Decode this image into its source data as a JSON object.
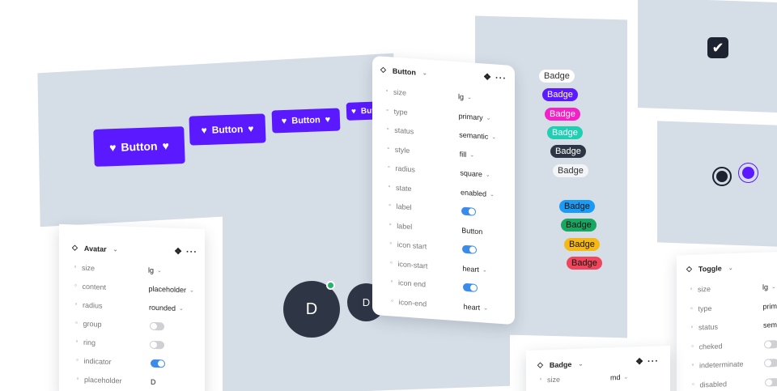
{
  "buttons": {
    "label": "Button",
    "icon": "heart-icon"
  },
  "badges_left": [
    "Badge",
    "Badge",
    "Badge",
    "Badge",
    "Badge",
    "Badge"
  ],
  "badges_right": [
    "Badge",
    "Badge",
    "Badge",
    "Badge"
  ],
  "avatar_initial": "D",
  "button_panel": {
    "title": "Button",
    "rows": [
      {
        "prop": "size",
        "value": "lg"
      },
      {
        "prop": "type",
        "value": "primary"
      },
      {
        "prop": "status",
        "value": "semantic"
      },
      {
        "prop": "style",
        "value": "fill"
      },
      {
        "prop": "radius",
        "value": "square"
      },
      {
        "prop": "state",
        "value": "enabled"
      },
      {
        "prop": "label",
        "value": ""
      },
      {
        "prop": "label",
        "value": "Button"
      },
      {
        "prop": "icon start",
        "value": ""
      },
      {
        "prop": "icon-start",
        "value": "heart"
      },
      {
        "prop": "icon end",
        "value": ""
      },
      {
        "prop": "icon-end",
        "value": "heart"
      }
    ]
  },
  "avatar_panel": {
    "title": "Avatar",
    "rows": [
      {
        "prop": "size",
        "value": "lg"
      },
      {
        "prop": "content",
        "value": "placeholder"
      },
      {
        "prop": "radius",
        "value": "rounded"
      },
      {
        "prop": "group",
        "value": ""
      },
      {
        "prop": "ring",
        "value": ""
      },
      {
        "prop": "indicator",
        "value": ""
      },
      {
        "prop": "placeholder",
        "value": "D"
      }
    ]
  },
  "toggle_panel": {
    "title": "Toggle",
    "rows": [
      {
        "prop": "size",
        "value": "lg"
      },
      {
        "prop": "type",
        "value": "primary"
      },
      {
        "prop": "status",
        "value": "seman"
      },
      {
        "prop": "cheked",
        "value": ""
      },
      {
        "prop": "indeterminate",
        "value": ""
      },
      {
        "prop": "disabled",
        "value": ""
      }
    ]
  },
  "badge_panel": {
    "title": "Badge",
    "rows": [
      {
        "prop": "size",
        "value": "md"
      }
    ]
  },
  "colors": {
    "primary": "#5b19ff",
    "frame": "#d5dde6",
    "toggle_on": "#3b8beb",
    "indicator": "#1fb56a"
  }
}
